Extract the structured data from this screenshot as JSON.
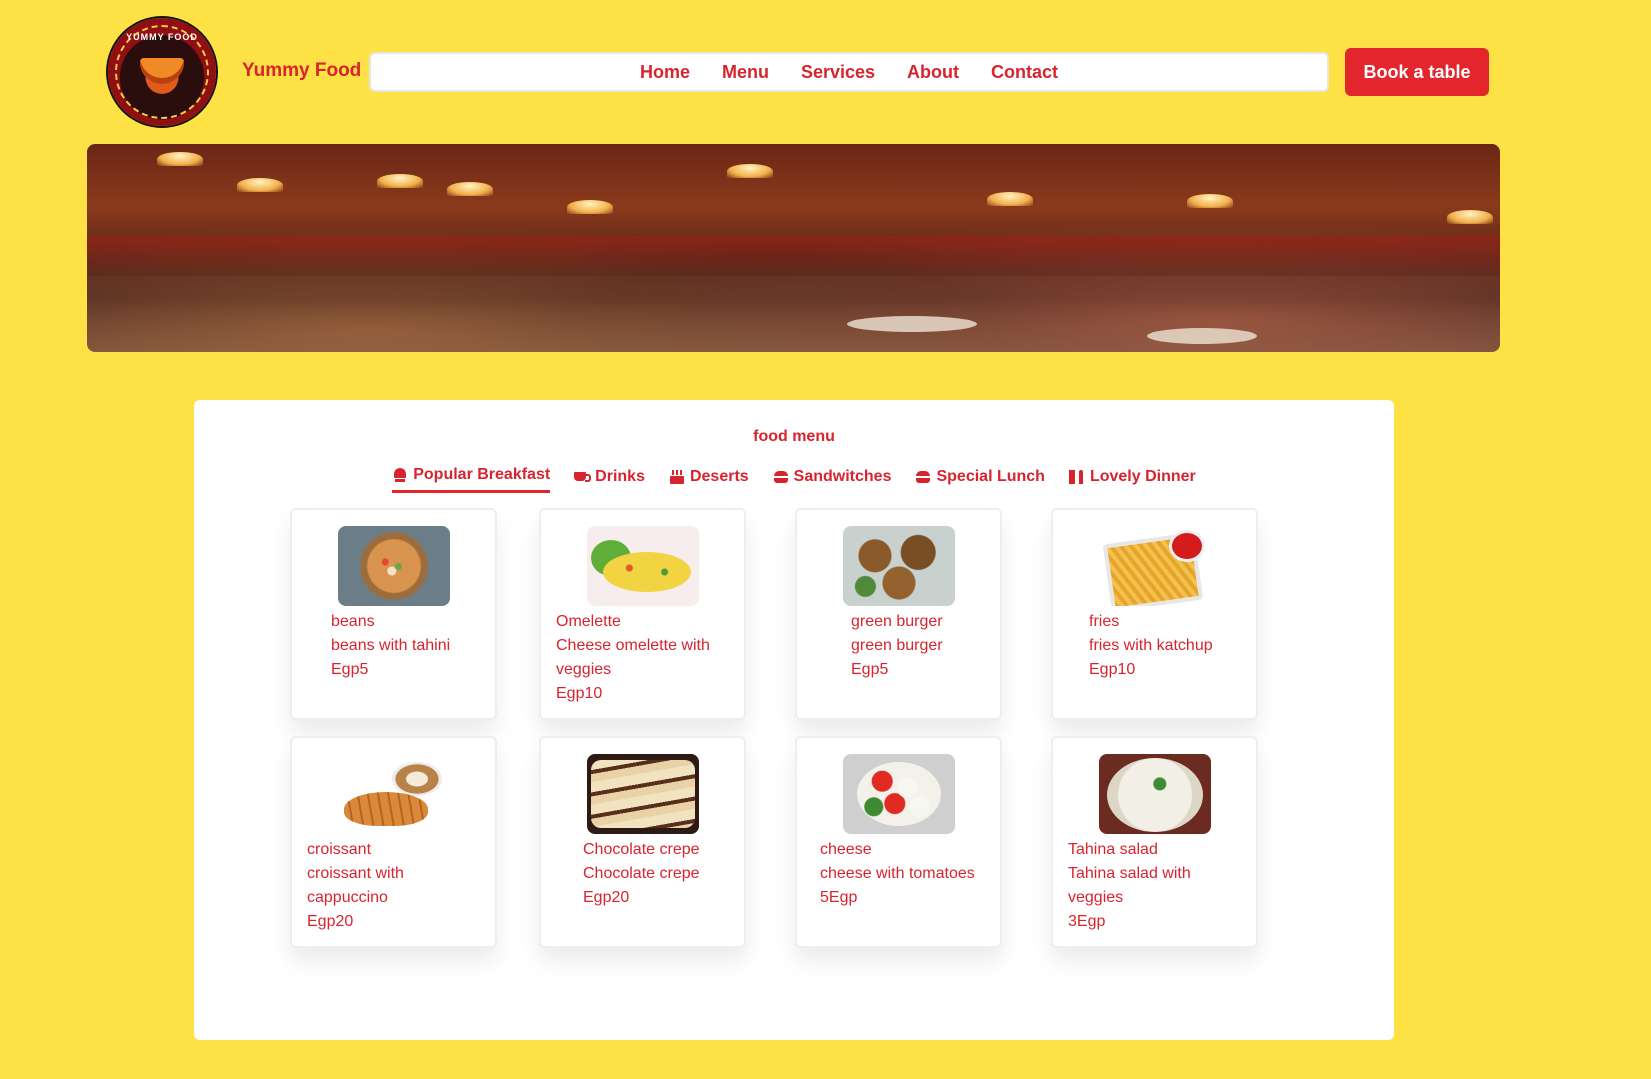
{
  "header": {
    "logo_text": "YUMMY FOOD",
    "brand": "Yummy Food",
    "nav": [
      "Home",
      "Menu",
      "Services",
      "About",
      "Contact"
    ],
    "cta": "Book a table"
  },
  "menu": {
    "title": "food menu",
    "tabs": [
      {
        "label": "Popular Breakfast",
        "icon": "chef-hat-icon",
        "active": true
      },
      {
        "label": "Drinks",
        "icon": "coffee-cup-icon",
        "active": false
      },
      {
        "label": "Deserts",
        "icon": "cake-icon",
        "active": false
      },
      {
        "label": "Sandwitches",
        "icon": "burger-icon",
        "active": false
      },
      {
        "label": "Special Lunch",
        "icon": "burger-icon",
        "active": false
      },
      {
        "label": "Lovely Dinner",
        "icon": "utensils-icon",
        "active": false
      }
    ],
    "items": [
      {
        "name": "beans",
        "desc": "beans with tahini",
        "price": "Egp5"
      },
      {
        "name": "Omelette",
        "desc": "Cheese omelette with",
        "desc2": "veggies",
        "price": "Egp10"
      },
      {
        "name": "green burger",
        "desc": "green burger",
        "price": "Egp5"
      },
      {
        "name": "fries",
        "desc": "fries with katchup",
        "price": "Egp10"
      },
      {
        "name": "croissant",
        "desc": "croissant with",
        "desc2": "cappuccino",
        "price": "Egp20"
      },
      {
        "name": "Chocolate crepe",
        "desc": "Chocolate crepe",
        "price": "Egp20"
      },
      {
        "name": "cheese",
        "desc": "cheese with tomatoes",
        "price": "5Egp"
      },
      {
        "name": "Tahina salad",
        "desc": "Tahina salad with",
        "desc2": "veggies",
        "price": "3Egp"
      }
    ]
  },
  "colors": {
    "page_bg": "#fee245",
    "accent": "#d7242e",
    "button_bg": "#e3262d"
  }
}
